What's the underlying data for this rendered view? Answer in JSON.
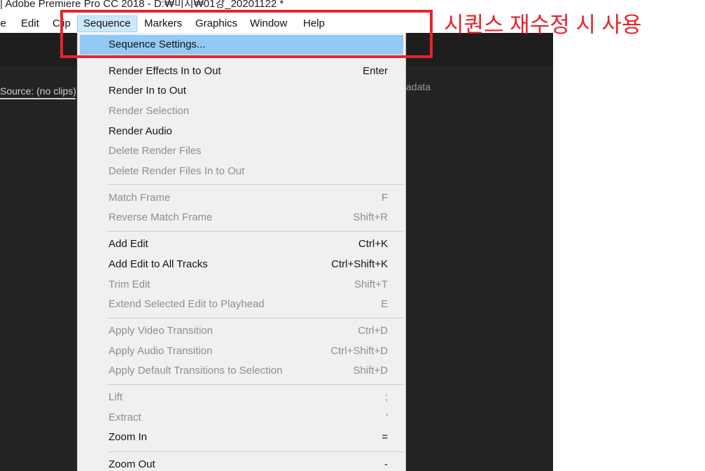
{
  "window": {
    "title": "| Adobe Premiere Pro CC 2018 - D:₩미지₩01강_20201122 *"
  },
  "menubar": {
    "items": [
      {
        "label": "le",
        "name": "menu-file"
      },
      {
        "label": "Edit",
        "name": "menu-edit"
      },
      {
        "label": "Clip",
        "name": "menu-clip"
      },
      {
        "label": "Sequence",
        "name": "menu-sequence",
        "active": true
      },
      {
        "label": "Markers",
        "name": "menu-markers"
      },
      {
        "label": "Graphics",
        "name": "menu-graphics"
      },
      {
        "label": "Window",
        "name": "menu-window"
      },
      {
        "label": "Help",
        "name": "menu-help"
      }
    ]
  },
  "panels": {
    "source_tab": "Source: (no clips)",
    "metadata_tab": "adata"
  },
  "sequence_menu": {
    "items": [
      {
        "label": "Sequence Settings...",
        "shortcut": "",
        "enabled": true,
        "highlighted": true
      },
      {
        "label": "Render Effects In to Out",
        "shortcut": "Enter",
        "enabled": true
      },
      {
        "label": "Render In to Out",
        "shortcut": "",
        "enabled": true
      },
      {
        "label": "Render Selection",
        "shortcut": "",
        "enabled": false
      },
      {
        "label": "Render Audio",
        "shortcut": "",
        "enabled": true
      },
      {
        "label": "Delete Render Files",
        "shortcut": "",
        "enabled": false
      },
      {
        "label": "Delete Render Files In to Out",
        "shortcut": "",
        "enabled": false
      },
      {
        "separator": true
      },
      {
        "label": "Match Frame",
        "shortcut": "F",
        "enabled": false
      },
      {
        "label": "Reverse Match Frame",
        "shortcut": "Shift+R",
        "enabled": false
      },
      {
        "separator": true
      },
      {
        "label": "Add Edit",
        "shortcut": "Ctrl+K",
        "enabled": true
      },
      {
        "label": "Add Edit to All Tracks",
        "shortcut": "Ctrl+Shift+K",
        "enabled": true
      },
      {
        "label": "Trim Edit",
        "shortcut": "Shift+T",
        "enabled": false
      },
      {
        "label": "Extend Selected Edit to Playhead",
        "shortcut": "E",
        "enabled": false
      },
      {
        "separator": true
      },
      {
        "label": "Apply Video Transition",
        "shortcut": "Ctrl+D",
        "enabled": false
      },
      {
        "label": "Apply Audio Transition",
        "shortcut": "Ctrl+Shift+D",
        "enabled": false
      },
      {
        "label": "Apply Default Transitions to Selection",
        "shortcut": "Shift+D",
        "enabled": false
      },
      {
        "separator": true
      },
      {
        "label": "Lift",
        "shortcut": ";",
        "enabled": false
      },
      {
        "label": "Extract",
        "shortcut": "'",
        "enabled": false
      },
      {
        "separator": true
      },
      {
        "label": "Zoom In",
        "shortcut": "=",
        "enabled": true
      },
      {
        "label": "Zoom Out",
        "shortcut": "-",
        "enabled": true
      }
    ]
  },
  "annotation": {
    "text": "시퀀스 재수정 시 사용",
    "color": "#e8232a"
  },
  "colors": {
    "highlight": "#91c9f7",
    "menu_bg": "#f0f0f0",
    "dark_panel": "#232323",
    "accent_red": "#e8232a"
  }
}
